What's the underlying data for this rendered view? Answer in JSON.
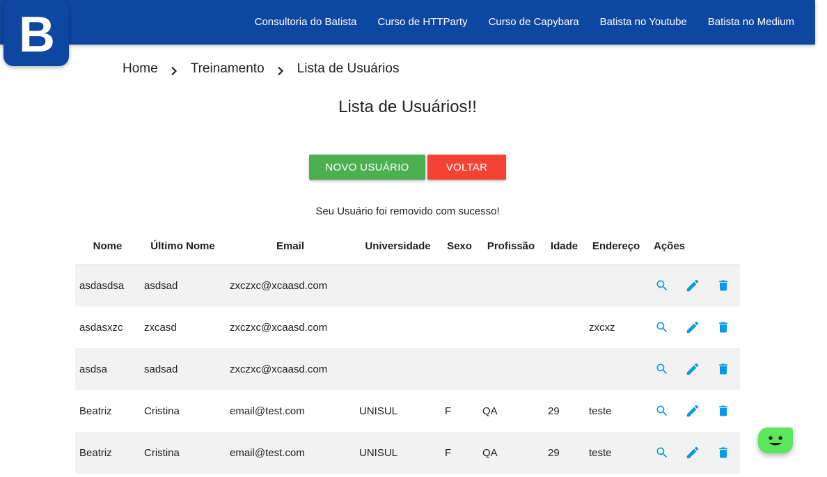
{
  "brand": {
    "logo_letter": "B",
    "color": "#0d47a1"
  },
  "nav": {
    "links": [
      "Consultoria do Batista",
      "Curso de HTTParty",
      "Curso de Capybara",
      "Batista no Youtube",
      "Batista no Medium"
    ]
  },
  "breadcrumb": [
    "Home",
    "Treinamento",
    "Lista de Usuários"
  ],
  "page": {
    "title": "Lista de Usuários!!",
    "new_user_label": "Novo Usuário",
    "back_label": "Voltar",
    "message": "Seu Usuário foi removido com sucesso!"
  },
  "table": {
    "headers": [
      "Nome",
      "Último Nome",
      "Email",
      "Universidade",
      "Sexo",
      "Profissão",
      "Idade",
      "Endereço",
      "Ações"
    ],
    "rows": [
      [
        "asdasdsa",
        "asdsad",
        "zxczxc@xcaasd.com",
        "",
        "",
        "",
        "",
        ""
      ],
      [
        "asdasxzc",
        "zxcasd",
        "zxczxc@xcaasd.com",
        "",
        "",
        "",
        "",
        "zxcxz"
      ],
      [
        "asdsa",
        "sadsad",
        "zxczxc@xcaasd.com",
        "",
        "",
        "",
        "",
        ""
      ],
      [
        "Beatriz",
        "Cristina",
        "email@test.com",
        "UNISUL",
        "F",
        "QA",
        "29",
        "teste"
      ],
      [
        "Beatriz",
        "Cristina",
        "email@test.com",
        "UNISUL",
        "F",
        "QA",
        "29",
        "teste"
      ]
    ],
    "row_actions": [
      "search-icon",
      "pencil-icon",
      "trash-icon"
    ]
  },
  "colors": {
    "new_button": "#4caf50",
    "back_button": "#f44336",
    "action_icon": "#039be5",
    "chat_widget": "#5ce65c"
  }
}
